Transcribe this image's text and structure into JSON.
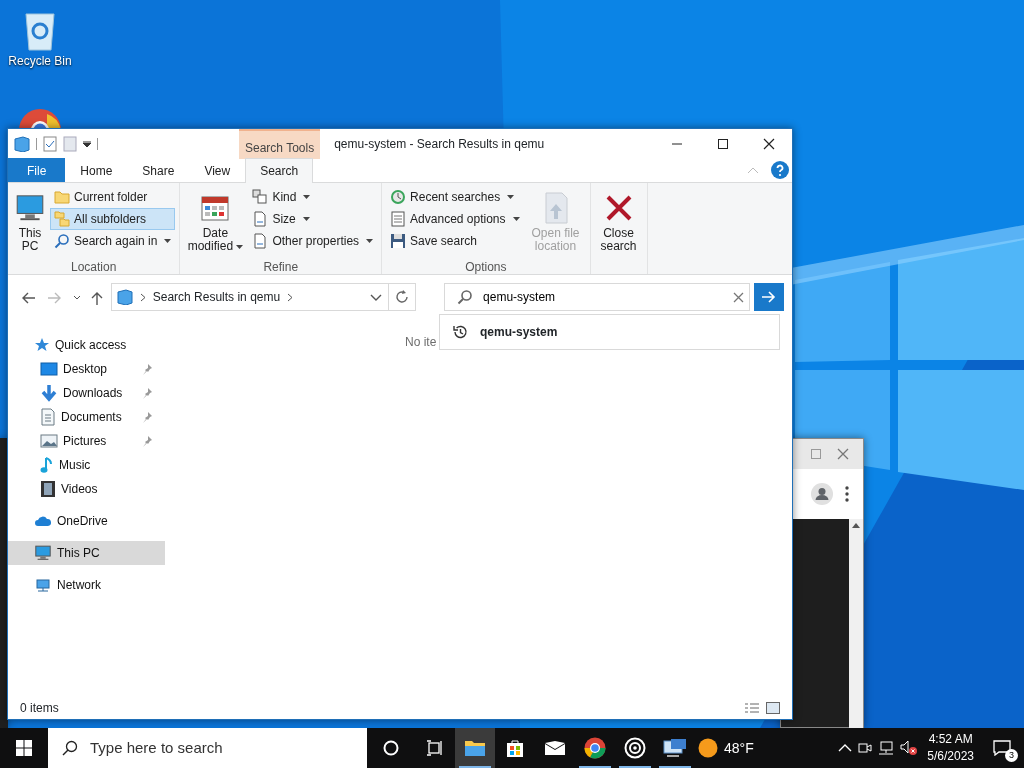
{
  "desktop": {
    "icons": [
      {
        "label": "Recycle Bin"
      }
    ]
  },
  "explorer": {
    "title": "qemu-system - Search Results in qemu",
    "context_tab": "Search Tools",
    "tabs": [
      {
        "label": "File",
        "kind": "file",
        "selected": false
      },
      {
        "label": "Home",
        "kind": "tab",
        "selected": false
      },
      {
        "label": "Share",
        "kind": "tab",
        "selected": false
      },
      {
        "label": "View",
        "kind": "tab",
        "selected": false
      },
      {
        "label": "Search",
        "kind": "tab",
        "selected": true
      }
    ],
    "ribbon": [
      {
        "label": "Location",
        "items": [
          {
            "label": "This PC",
            "kind": "large",
            "dropdown": false,
            "selected": false,
            "disabled": false
          },
          {
            "label": "Current folder",
            "kind": "small",
            "dropdown": false,
            "selected": false,
            "disabled": false
          },
          {
            "label": "All subfolders",
            "kind": "small",
            "dropdown": false,
            "selected": true,
            "disabled": false
          },
          {
            "label": "Search again in",
            "kind": "small",
            "dropdown": true,
            "selected": false,
            "disabled": false
          }
        ]
      },
      {
        "label": "Refine",
        "items": [
          {
            "label": "Date modified",
            "kind": "large",
            "dropdown": true,
            "selected": false,
            "disabled": false
          },
          {
            "label": "Kind",
            "kind": "small",
            "dropdown": true,
            "selected": false,
            "disabled": false
          },
          {
            "label": "Size",
            "kind": "small",
            "dropdown": true,
            "selected": false,
            "disabled": false
          },
          {
            "label": "Other properties",
            "kind": "small",
            "dropdown": true,
            "selected": false,
            "disabled": false
          }
        ]
      },
      {
        "label": "Options",
        "items": [
          {
            "label": "Recent searches",
            "kind": "small",
            "dropdown": true,
            "selected": false,
            "disabled": false
          },
          {
            "label": "Advanced options",
            "kind": "small",
            "dropdown": true,
            "selected": false,
            "disabled": false
          },
          {
            "label": "Save search",
            "kind": "small",
            "dropdown": false,
            "selected": false,
            "disabled": false
          },
          {
            "label": "Open file location",
            "kind": "large",
            "dropdown": false,
            "selected": false,
            "disabled": true
          }
        ]
      },
      {
        "items": [
          {
            "label": "Close search",
            "kind": "large",
            "dropdown": false,
            "selected": false,
            "disabled": false
          }
        ]
      }
    ],
    "address": {
      "path": "Search Results in qemu"
    },
    "search": {
      "value": "qemu-system"
    },
    "suggestions": [
      {
        "text": "qemu-system"
      }
    ],
    "nav": [
      {
        "label": "Quick access",
        "selected": false,
        "children": [
          {
            "label": "Desktop",
            "pinned": true,
            "selected": false
          },
          {
            "label": "Downloads",
            "pinned": true,
            "selected": false
          },
          {
            "label": "Documents",
            "pinned": true,
            "selected": false
          },
          {
            "label": "Pictures",
            "pinned": true,
            "selected": false
          },
          {
            "label": "Music",
            "pinned": false,
            "selected": false
          },
          {
            "label": "Videos",
            "pinned": false,
            "selected": false
          }
        ]
      },
      {
        "label": "OneDrive",
        "selected": false
      },
      {
        "label": "This PC",
        "selected": true
      },
      {
        "label": "Network",
        "selected": false
      }
    ],
    "empty_text": "No ite",
    "status": "0 items"
  },
  "taskbar": {
    "search_placeholder": "Type here to search",
    "apps": [
      {
        "running": true,
        "active": true
      },
      {
        "running": false,
        "active": false
      },
      {
        "running": false,
        "active": false
      },
      {
        "running": true,
        "active": false
      },
      {
        "running": true,
        "active": false
      },
      {
        "running": true,
        "active": false
      }
    ],
    "weather": "48°F",
    "time": "4:52 AM",
    "date": "5/6/2023",
    "notifications": "3"
  }
}
